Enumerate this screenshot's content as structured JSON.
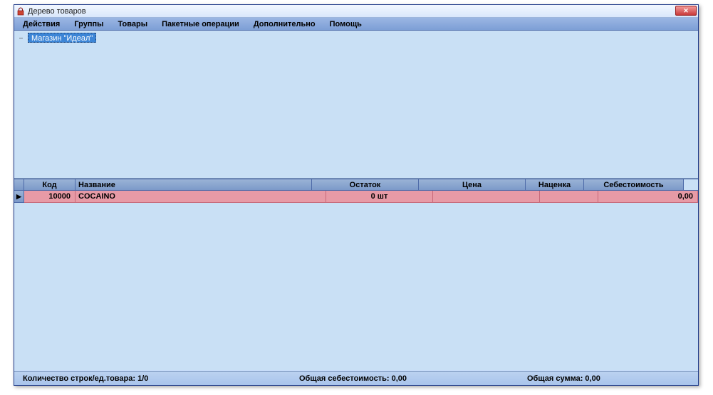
{
  "window": {
    "title": "Дерево товаров"
  },
  "menu": {
    "items": [
      "Действия",
      "Группы",
      "Товары",
      "Пакетные операции",
      "Дополнительно",
      "Помощь"
    ]
  },
  "tree": {
    "root": {
      "label": "Магазин \"Идеал\""
    }
  },
  "grid": {
    "headers": {
      "code": "Код",
      "name": "Название",
      "stock": "Остаток",
      "price": "Цена",
      "markup": "Наценка",
      "cost": "Себестоимость"
    },
    "rows": [
      {
        "code": "10000",
        "name": "COCAINO",
        "stock": "0 шт",
        "price": "",
        "markup": "",
        "cost": "0,00"
      }
    ]
  },
  "status": {
    "rows_label": "Количество строк/ед.товара:",
    "rows_value": "1/0",
    "total_cost_label": "Общая себестоимость:",
    "total_cost_value": "0,00",
    "total_sum_label": "Общая сумма:",
    "total_sum_value": "0,00"
  }
}
